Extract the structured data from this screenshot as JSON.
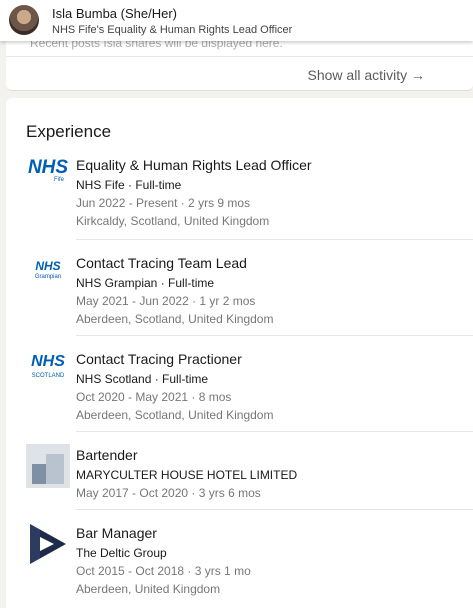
{
  "sticky_header": {
    "name": "Isla Bumba (She/Her)",
    "headline": "NHS Fife's Equality & Human Rights Lead Officer"
  },
  "activity": {
    "peek_text": "Recent posts Isla shares will be displayed here.",
    "show_all_label": "Show all activity →"
  },
  "experience": {
    "title": "Experience",
    "entries": [
      {
        "role": "Equality & Human Rights Lead Officer",
        "company": "NHS Fife · Full-time",
        "dates": "Jun 2022 - Present · 2 yrs 9 mos",
        "location": "Kirkcaldy, Scotland, United Kingdom",
        "logo": {
          "word": "NHS",
          "sub": "Fife"
        }
      },
      {
        "role": "Contact Tracing Team Lead",
        "company": "NHS Grampian · Full-time",
        "dates": "May 2021 - Jun 2022 · 1 yr 2 mos",
        "location": "Aberdeen, Scotland, United Kingdom",
        "logo": {
          "word": "NHS",
          "sub": "Grampian"
        }
      },
      {
        "role": "Contact Tracing Practioner",
        "company": "NHS Scotland · Full-time",
        "dates": "Oct 2020 - May 2021 · 8 mos",
        "location": "Aberdeen, Scotland, United Kingdom",
        "logo": {
          "word": "NHS",
          "sub": "SCOTLAND"
        }
      },
      {
        "role": "Bartender",
        "company": "MARYCULTER HOUSE HOTEL LIMITED",
        "dates": "May 2017 - Oct 2020 · 3 yrs 6 mos",
        "logo": {
          "type": "placeholder"
        }
      },
      {
        "role": "Bar Manager",
        "company": "The Deltic Group",
        "dates": "Oct 2015 - Oct 2018 · 3 yrs 1 mo",
        "location": "Aberdeen, United Kingdom",
        "logo": {
          "type": "deltic-mark"
        }
      }
    ]
  },
  "colors": {
    "nhs_blue": "#005eb8",
    "deltic_navy": "#1e2a4a",
    "placeholder_light": "#dfe3e8",
    "placeholder_dark": "#9aa8b8"
  }
}
